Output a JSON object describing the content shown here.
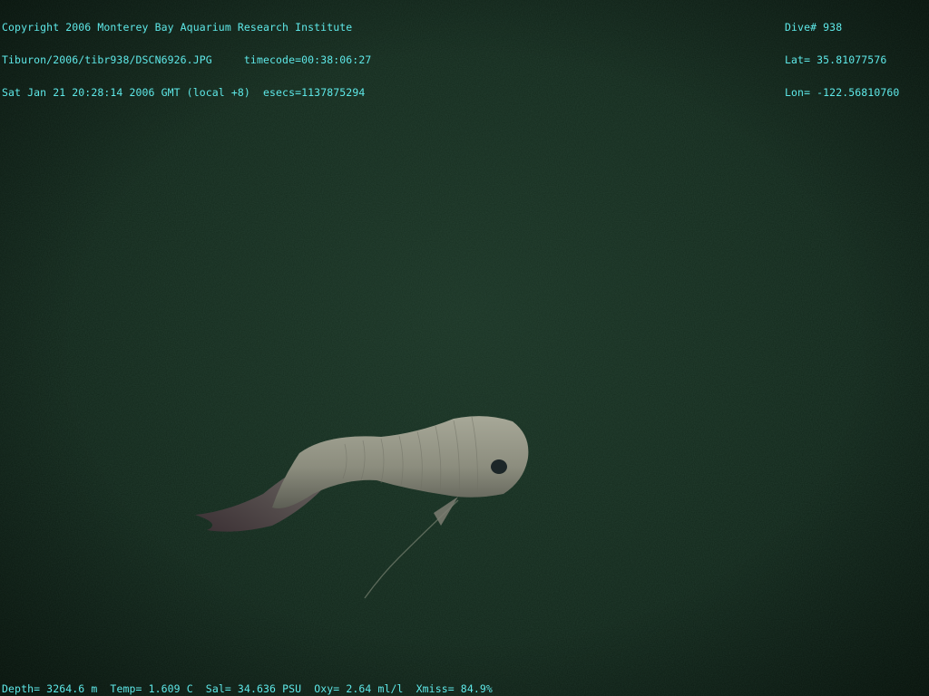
{
  "header": {
    "copyright": "Copyright 2006 Monterey Bay Aquarium Research Institute",
    "file_path": "Tiburon/2006/tibr938/DSCN6926.JPG",
    "timecode": "timecode=00:38:06:27",
    "datetime": "Sat Jan 21 20:28:14 2006 GMT (local +8)",
    "esecs": "esecs=1137875294"
  },
  "position": {
    "dive": "Dive# 938",
    "lat": "Lat= 35.81077576",
    "lon": "Lon= -122.56810760"
  },
  "sensors": {
    "depth": "Depth= 3264.6 m",
    "temp": "Temp= 1.609 C",
    "sal": "Sal= 34.636 PSU",
    "oxy": "Oxy= 2.64 ml/l",
    "xmiss": "Xmiss= 84.9%"
  },
  "colors": {
    "overlay_text": "#5ee8e8",
    "water": "#142a1d"
  }
}
